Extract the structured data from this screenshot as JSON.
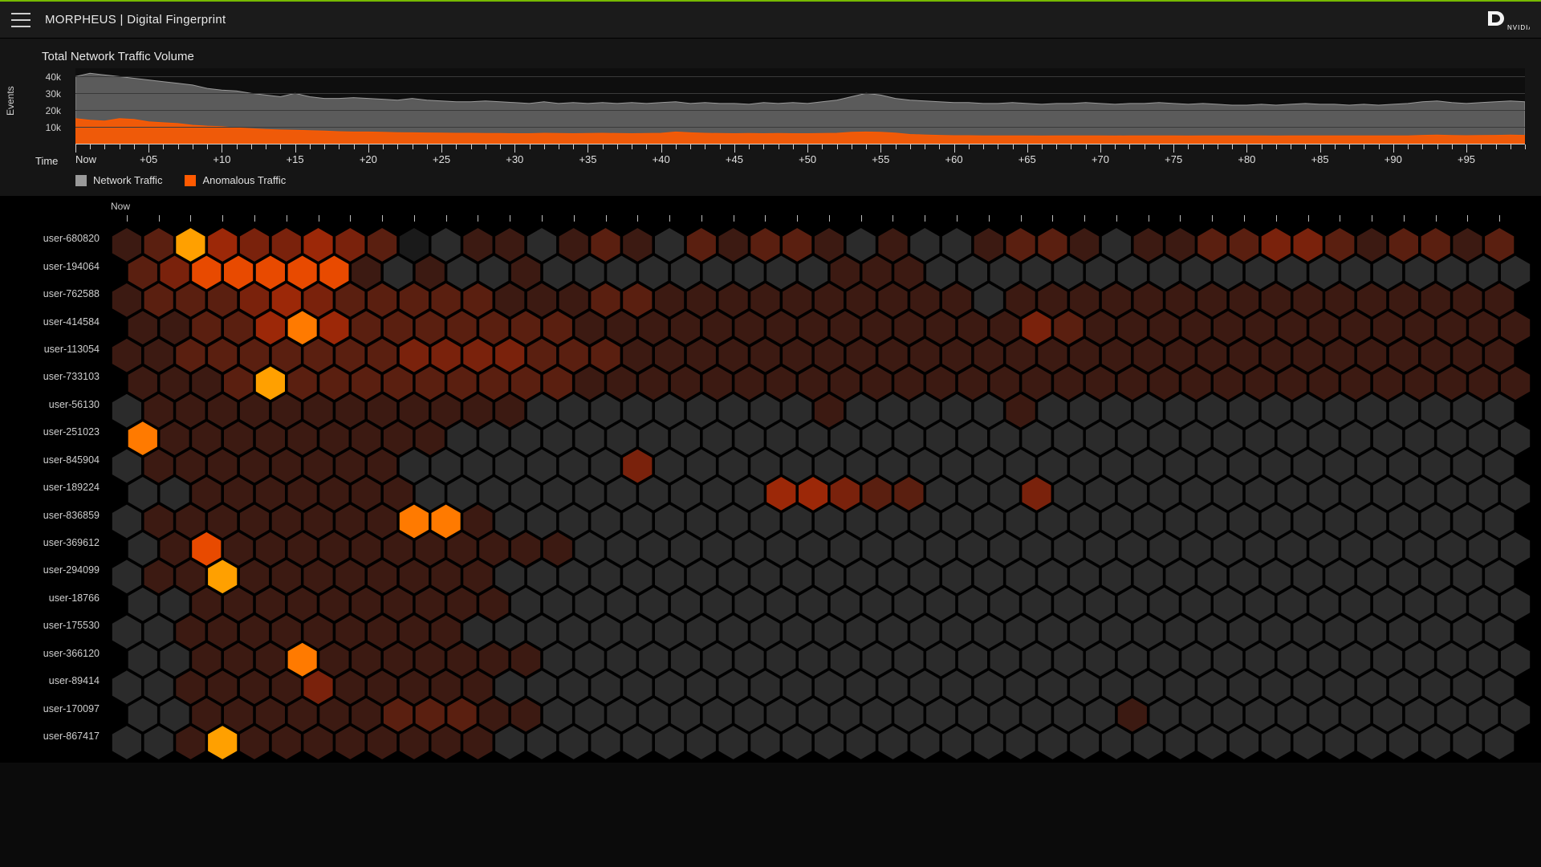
{
  "header": {
    "title": "MORPHEUS | Digital Fingerprint",
    "logo_label": "NVIDIA"
  },
  "colors": {
    "accent": "#76b900",
    "network": "#9a9a9a",
    "anomalous": "#ff5a00",
    "heat_scale": [
      "#1a1a1a",
      "#2b2b2b",
      "#3c1a12",
      "#5a1f10",
      "#7a220c",
      "#9c2808",
      "#c23104",
      "#e84a00",
      "#ff7a00",
      "#ffa000"
    ]
  },
  "chart_data": {
    "type": "area",
    "title": "Total Network Traffic Volume",
    "xlabel": "Time",
    "ylabel": "Events",
    "ylim": [
      0,
      45000
    ],
    "yticks": [
      10000,
      20000,
      30000,
      40000
    ],
    "ytick_labels": [
      "10k",
      "20k",
      "30k",
      "40k"
    ],
    "x_major_every": 5,
    "x_first_label": "Now",
    "x_labels": [
      "Now",
      "+05",
      "+10",
      "+15",
      "+20",
      "+25",
      "+30",
      "+35",
      "+40",
      "+45",
      "+50",
      "+55",
      "+60",
      "+65",
      "+70",
      "+75",
      "+80",
      "+85",
      "+90",
      "+95"
    ],
    "legend": [
      "Network Traffic",
      "Anomalous Traffic"
    ],
    "series": [
      {
        "name": "Network Traffic",
        "color": "#9a9a9a",
        "values": [
          40000,
          42000,
          41000,
          40000,
          39000,
          38000,
          37000,
          36000,
          35000,
          33000,
          32000,
          31500,
          30000,
          29000,
          28000,
          30000,
          28000,
          27000,
          27000,
          27500,
          27000,
          26500,
          26000,
          27000,
          26000,
          25500,
          25000,
          25000,
          25500,
          25000,
          24500,
          24000,
          25000,
          24000,
          24500,
          24000,
          24500,
          24000,
          24500,
          24000,
          24500,
          25000,
          24000,
          24500,
          24000,
          24000,
          23500,
          24500,
          24000,
          24500,
          24000,
          25000,
          26000,
          28000,
          30000,
          29000,
          27000,
          26000,
          25500,
          25000,
          24500,
          24500,
          24000,
          24000,
          24500,
          24000,
          23500,
          24000,
          24000,
          24500,
          24000,
          23500,
          24000,
          24000,
          24500,
          24000,
          23500,
          24000,
          23500,
          23000,
          23000,
          23500,
          23000,
          23500,
          24000,
          23500,
          23500,
          23000,
          23500,
          23000,
          23500,
          24000,
          25000,
          25500,
          24500,
          24000,
          24500,
          25000,
          25500,
          25000
        ]
      },
      {
        "name": "Anomalous Traffic",
        "color": "#ff5a00",
        "values": [
          15000,
          14000,
          13500,
          15000,
          14500,
          13000,
          12500,
          12000,
          11000,
          10500,
          10200,
          9500,
          9000,
          8500,
          8200,
          8000,
          7800,
          7500,
          7200,
          7000,
          7000,
          6800,
          6600,
          6500,
          6400,
          6300,
          6200,
          6200,
          6100,
          6100,
          6000,
          6000,
          6200,
          6100,
          6000,
          6100,
          6200,
          6100,
          6000,
          6100,
          6200,
          7000,
          6500,
          6200,
          6100,
          6000,
          6100,
          6000,
          6100,
          6000,
          6000,
          6100,
          6200,
          6800,
          7000,
          6800,
          6300,
          5500,
          5200,
          5000,
          4800,
          4800,
          4700,
          4700,
          4700,
          4700,
          4600,
          4700,
          4700,
          4700,
          4700,
          4600,
          4700,
          4700,
          4700,
          4700,
          4600,
          4700,
          4700,
          4700,
          4700,
          4700,
          4600,
          4700,
          4700,
          4700,
          4700,
          4700,
          4700,
          4700,
          4700,
          4700,
          5000,
          5100,
          4900,
          4800,
          4900,
          5000,
          5100,
          5000
        ]
      }
    ]
  },
  "heatmap": {
    "type": "heatmap",
    "time_label": "Now",
    "cols": 44,
    "users": [
      "user-680820",
      "user-194064",
      "user-762588",
      "user-414584",
      "user-113054",
      "user-733103",
      "user-56130",
      "user-251023",
      "user-845904",
      "user-189224",
      "user-836859",
      "user-369612",
      "user-294099",
      "user-18766",
      "user-175530",
      "user-366120",
      "user-89414",
      "user-170097",
      "user-867417"
    ],
    "intensity_comment": "values 0-9; 0=dark grey, 9=bright orange",
    "values": [
      [
        2,
        3,
        9,
        5,
        4,
        4,
        5,
        4,
        3,
        0,
        1,
        2,
        2,
        1,
        2,
        3,
        2,
        1,
        3,
        2,
        3,
        3,
        2,
        1,
        2,
        1,
        1,
        2,
        3,
        3,
        2,
        1,
        2,
        2,
        3,
        3,
        4,
        4,
        3,
        2,
        3,
        3,
        2,
        3
      ],
      [
        3,
        4,
        7,
        7,
        7,
        7,
        7,
        2,
        1,
        2,
        1,
        1,
        2,
        1,
        1,
        1,
        1,
        1,
        1,
        1,
        1,
        1,
        2,
        2,
        2,
        1,
        1,
        1,
        1,
        1,
        1,
        1,
        1,
        1,
        1,
        1,
        1,
        1,
        1,
        1,
        1,
        1,
        1,
        1
      ],
      [
        2,
        3,
        3,
        3,
        4,
        5,
        4,
        3,
        3,
        3,
        3,
        3,
        2,
        2,
        2,
        3,
        3,
        2,
        2,
        2,
        2,
        2,
        2,
        2,
        2,
        2,
        2,
        1,
        2,
        2,
        2,
        2,
        2,
        2,
        2,
        2,
        2,
        2,
        2,
        2,
        2,
        2,
        2,
        2
      ],
      [
        2,
        2,
        3,
        3,
        5,
        8,
        5,
        3,
        3,
        3,
        3,
        3,
        3,
        3,
        2,
        2,
        2,
        2,
        2,
        2,
        2,
        2,
        2,
        2,
        2,
        2,
        2,
        2,
        4,
        3,
        2,
        2,
        2,
        2,
        2,
        2,
        2,
        2,
        2,
        2,
        2,
        2,
        2,
        2
      ],
      [
        2,
        2,
        3,
        3,
        3,
        3,
        3,
        3,
        3,
        4,
        4,
        4,
        4,
        3,
        3,
        3,
        2,
        2,
        2,
        2,
        2,
        2,
        2,
        2,
        2,
        2,
        2,
        2,
        2,
        2,
        2,
        2,
        2,
        2,
        2,
        2,
        2,
        2,
        2,
        2,
        2,
        2,
        2,
        2
      ],
      [
        2,
        2,
        2,
        3,
        9,
        3,
        3,
        3,
        3,
        3,
        3,
        3,
        3,
        3,
        2,
        2,
        2,
        2,
        2,
        2,
        2,
        2,
        2,
        2,
        2,
        2,
        2,
        2,
        2,
        2,
        2,
        2,
        2,
        2,
        2,
        2,
        2,
        2,
        2,
        2,
        2,
        2,
        2,
        2
      ],
      [
        1,
        2,
        2,
        2,
        2,
        2,
        2,
        2,
        2,
        2,
        2,
        2,
        2,
        1,
        1,
        1,
        1,
        1,
        1,
        1,
        1,
        1,
        2,
        1,
        1,
        1,
        1,
        1,
        2,
        1,
        1,
        1,
        1,
        1,
        1,
        1,
        1,
        1,
        1,
        1,
        1,
        1,
        1,
        1
      ],
      [
        8,
        2,
        2,
        2,
        2,
        2,
        2,
        2,
        2,
        2,
        1,
        1,
        1,
        1,
        1,
        1,
        1,
        1,
        1,
        1,
        1,
        1,
        1,
        1,
        1,
        1,
        1,
        1,
        1,
        1,
        1,
        1,
        1,
        1,
        1,
        1,
        1,
        1,
        1,
        1,
        1,
        1,
        1,
        1
      ],
      [
        1,
        2,
        2,
        2,
        2,
        2,
        2,
        2,
        2,
        1,
        1,
        1,
        1,
        1,
        1,
        1,
        4,
        1,
        1,
        1,
        1,
        1,
        1,
        1,
        1,
        1,
        1,
        1,
        1,
        1,
        1,
        1,
        1,
        1,
        1,
        1,
        1,
        1,
        1,
        1,
        1,
        1,
        1,
        1
      ],
      [
        1,
        1,
        2,
        2,
        2,
        2,
        2,
        2,
        2,
        1,
        1,
        1,
        1,
        1,
        1,
        1,
        1,
        1,
        1,
        1,
        5,
        5,
        4,
        3,
        3,
        1,
        1,
        1,
        4,
        1,
        1,
        1,
        1,
        1,
        1,
        1,
        1,
        1,
        1,
        1,
        1,
        1,
        1,
        1
      ],
      [
        1,
        2,
        2,
        2,
        2,
        2,
        2,
        2,
        2,
        8,
        8,
        2,
        1,
        1,
        1,
        1,
        1,
        1,
        1,
        1,
        1,
        1,
        1,
        1,
        1,
        1,
        1,
        1,
        1,
        1,
        1,
        1,
        1,
        1,
        1,
        1,
        1,
        1,
        1,
        1,
        1,
        1,
        1,
        1
      ],
      [
        1,
        2,
        7,
        2,
        2,
        2,
        2,
        2,
        2,
        2,
        2,
        2,
        2,
        2,
        1,
        1,
        1,
        1,
        1,
        1,
        1,
        1,
        1,
        1,
        1,
        1,
        1,
        1,
        1,
        1,
        1,
        1,
        1,
        1,
        1,
        1,
        1,
        1,
        1,
        1,
        1,
        1,
        1,
        1
      ],
      [
        1,
        2,
        2,
        9,
        2,
        2,
        2,
        2,
        2,
        2,
        2,
        2,
        1,
        1,
        1,
        1,
        1,
        1,
        1,
        1,
        1,
        1,
        1,
        1,
        1,
        1,
        1,
        1,
        1,
        1,
        1,
        1,
        1,
        1,
        1,
        1,
        1,
        1,
        1,
        1,
        1,
        1,
        1,
        1
      ],
      [
        1,
        1,
        2,
        2,
        2,
        2,
        2,
        2,
        2,
        2,
        2,
        2,
        1,
        1,
        1,
        1,
        1,
        1,
        1,
        1,
        1,
        1,
        1,
        1,
        1,
        1,
        1,
        1,
        1,
        1,
        1,
        1,
        1,
        1,
        1,
        1,
        1,
        1,
        1,
        1,
        1,
        1,
        1,
        1
      ],
      [
        1,
        1,
        2,
        2,
        2,
        2,
        2,
        2,
        2,
        2,
        2,
        1,
        1,
        1,
        1,
        1,
        1,
        1,
        1,
        1,
        1,
        1,
        1,
        1,
        1,
        1,
        1,
        1,
        1,
        1,
        1,
        1,
        1,
        1,
        1,
        1,
        1,
        1,
        1,
        1,
        1,
        1,
        1,
        1
      ],
      [
        1,
        1,
        2,
        2,
        2,
        8,
        2,
        2,
        2,
        2,
        2,
        2,
        2,
        1,
        1,
        1,
        1,
        1,
        1,
        1,
        1,
        1,
        1,
        1,
        1,
        1,
        1,
        1,
        1,
        1,
        1,
        1,
        1,
        1,
        1,
        1,
        1,
        1,
        1,
        1,
        1,
        1,
        1,
        1
      ],
      [
        1,
        1,
        2,
        2,
        2,
        2,
        4,
        2,
        2,
        2,
        2,
        2,
        1,
        1,
        1,
        1,
        1,
        1,
        1,
        1,
        1,
        1,
        1,
        1,
        1,
        1,
        1,
        1,
        1,
        1,
        1,
        1,
        1,
        1,
        1,
        1,
        1,
        1,
        1,
        1,
        1,
        1,
        1,
        1
      ],
      [
        1,
        1,
        2,
        2,
        2,
        2,
        2,
        2,
        3,
        3,
        3,
        2,
        2,
        1,
        1,
        1,
        1,
        1,
        1,
        1,
        1,
        1,
        1,
        1,
        1,
        1,
        1,
        1,
        1,
        1,
        1,
        2,
        1,
        1,
        1,
        1,
        1,
        1,
        1,
        1,
        1,
        1,
        1,
        1
      ],
      [
        1,
        1,
        2,
        9,
        2,
        2,
        2,
        2,
        2,
        2,
        2,
        2,
        1,
        1,
        1,
        1,
        1,
        1,
        1,
        1,
        1,
        1,
        1,
        1,
        1,
        1,
        1,
        1,
        1,
        1,
        1,
        1,
        1,
        1,
        1,
        1,
        1,
        1,
        1,
        1,
        1,
        1,
        1,
        1
      ]
    ]
  }
}
